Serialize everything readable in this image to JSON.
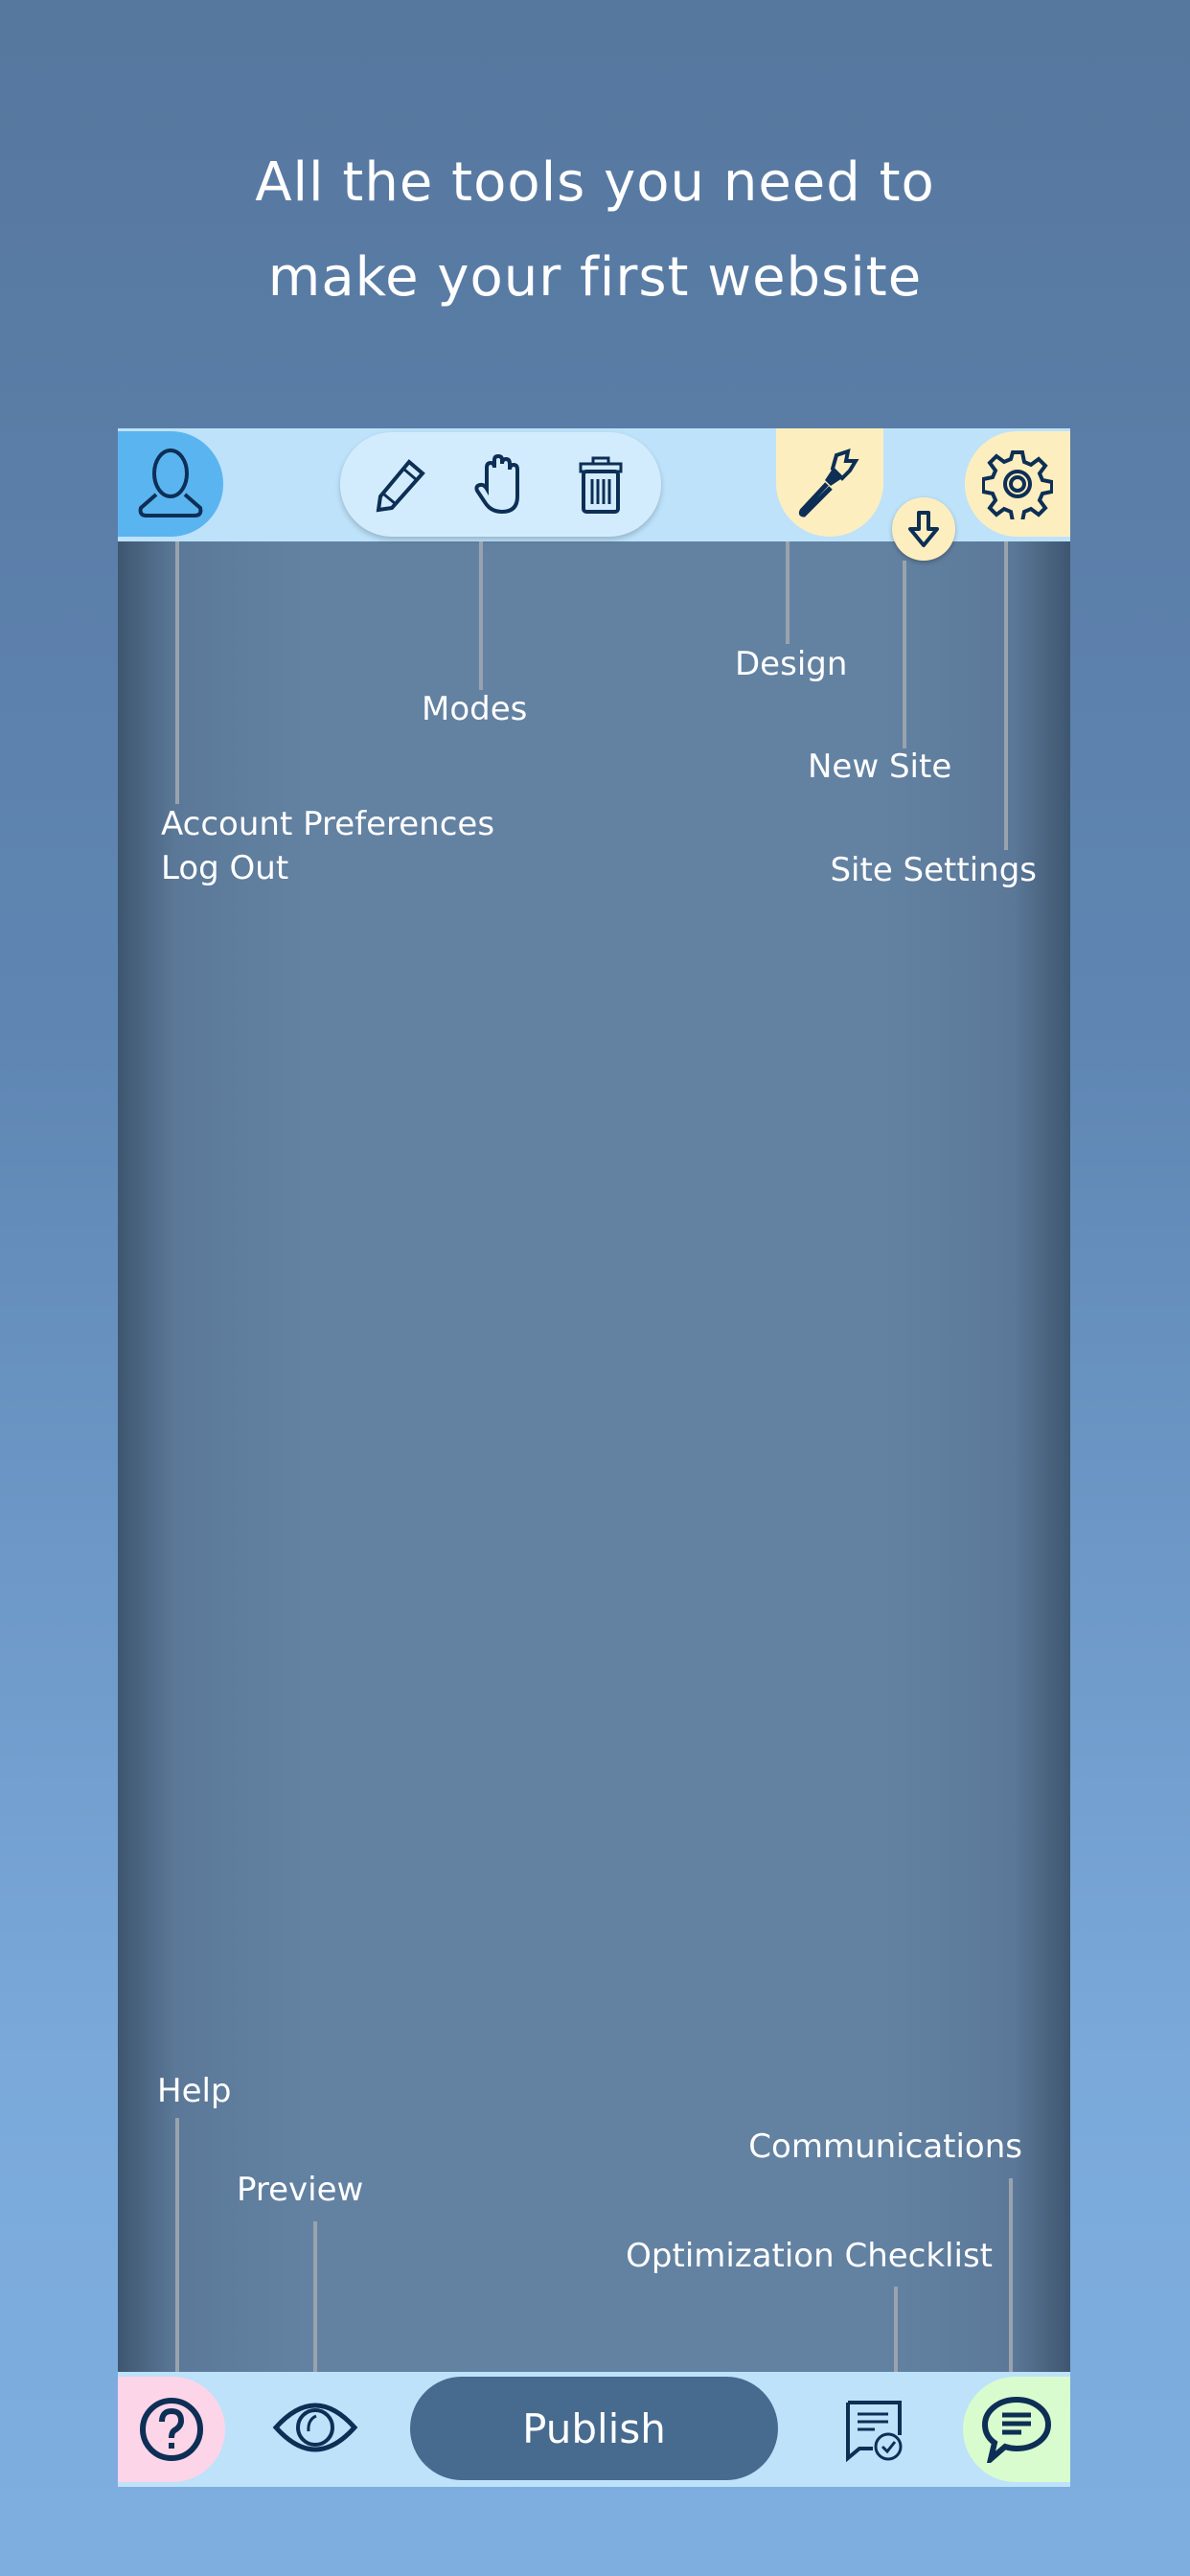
{
  "headline": {
    "line1": "All the tools you need to",
    "line2": "make your first website"
  },
  "top_bar": {
    "account": {
      "icon": "user-icon",
      "color": "#5ab4f0"
    },
    "modes": [
      "pencil-icon",
      "hand-icon",
      "trash-icon"
    ],
    "design": {
      "icon": "paintbrush-icon",
      "color": "#fdeebf"
    },
    "new_site": {
      "icon": "arrow-down-icon"
    },
    "settings": {
      "icon": "gear-icon"
    }
  },
  "callouts": {
    "account_preferences": "Account Preferences",
    "log_out": "Log Out",
    "modes": "Modes",
    "design": "Design",
    "new_site": "New Site",
    "site_settings": "Site Settings",
    "help": "Help",
    "preview": "Preview",
    "communications": "Communications",
    "optimization_checklist": "Optimization Checklist"
  },
  "bottom_bar": {
    "help": {
      "icon": "help-icon",
      "color": "#fcd5e8"
    },
    "preview": {
      "icon": "eye-icon"
    },
    "publish_label": "Publish",
    "checklist": {
      "icon": "checklist-icon"
    },
    "communications": {
      "icon": "chat-icon",
      "color": "#d9fccf"
    }
  }
}
